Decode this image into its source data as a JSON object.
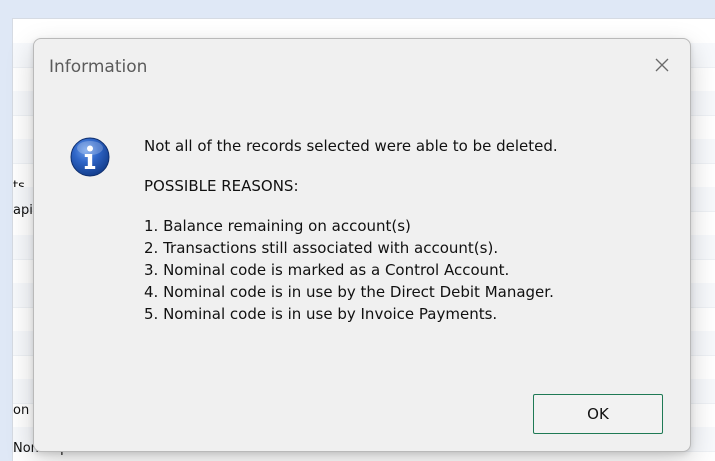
{
  "background": {
    "rows": [
      {
        "text": ""
      },
      {
        "text": ""
      },
      {
        "text": ""
      },
      {
        "text": ""
      },
      {
        "text": ""
      },
      {
        "text": "ts"
      },
      {
        "text": "apit"
      },
      {
        "text": ""
      },
      {
        "text": ""
      },
      {
        "text": ""
      },
      {
        "text": ""
      },
      {
        "text": ""
      },
      {
        "text": ""
      },
      {
        "text": ""
      },
      {
        "text": "on"
      },
      {
        "text": "Non Capital"
      }
    ]
  },
  "dialog": {
    "title": "Information",
    "close_icon": "close-icon",
    "icon": "info-icon",
    "message": {
      "line1": "Not all of the records selected were able to be deleted.",
      "heading": "POSSIBLE REASONS:",
      "reasons": [
        "1. Balance remaining on account(s)",
        "2. Transactions still associated with account(s).",
        "3. Nominal code is marked as a Control Account.",
        "4. Nominal code is in use by the Direct Debit Manager.",
        "5. Nominal code is in use by Invoice Payments."
      ]
    },
    "ok_label": "OK"
  },
  "colors": {
    "ok_border": "#1f7a55",
    "icon_blue": "#1b4fa8",
    "dialog_bg": "#f0f0f0"
  }
}
